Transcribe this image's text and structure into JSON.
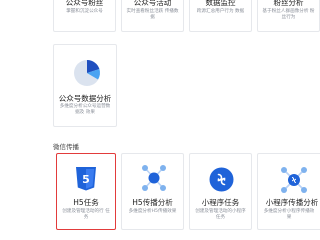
{
  "top_row": [
    {
      "title": "公众号粉丝",
      "desc": "掌握和沉淀公众号"
    },
    {
      "title": "公众号活动",
      "desc": "实时查看粉丝活跃 传播数据"
    },
    {
      "title": "数据监控",
      "desc": "跨源汇总用户行为 数据"
    },
    {
      "title": "粉丝分析",
      "desc": "基于粉丝人群画像分析 粉丝行为"
    }
  ],
  "cards": [
    {
      "title": "公众号数据分析",
      "desc": "多维度分析公众号运营数据及 效果"
    }
  ],
  "section": {
    "label": "微信传播"
  },
  "spread_cards": [
    {
      "title": "H5任务",
      "desc": "创建及管理活动的行 任务"
    },
    {
      "title": "H5传播分析",
      "desc": "多维度分析H5传播效果"
    },
    {
      "title": "小程序任务",
      "desc": "创建及管理活动的小程序任务"
    },
    {
      "title": "小程序传播分析",
      "desc": "多维度分析小程序传播效果"
    }
  ],
  "colors": {
    "accent": "#1677ff",
    "selected_border": "#e23b3b",
    "h5_blue": "#1f63d9"
  }
}
